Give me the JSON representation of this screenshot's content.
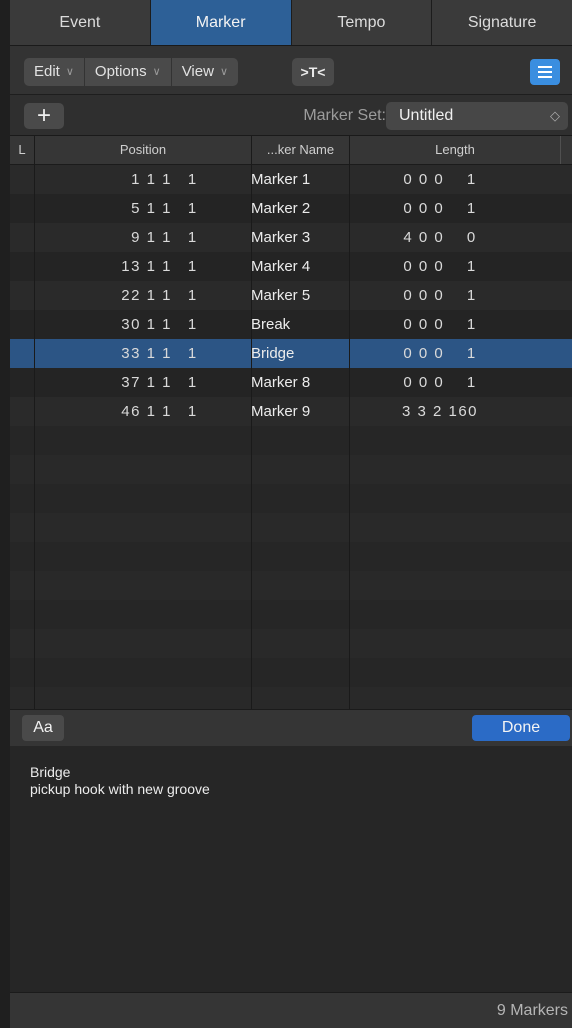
{
  "tabs": [
    "Event",
    "Marker",
    "Tempo",
    "Signature"
  ],
  "active_tab": "Marker",
  "toolbar": {
    "edit_label": "Edit",
    "options_label": "Options",
    "view_label": "View",
    "filter_glyph": ">T<",
    "chevron": "∨"
  },
  "marker_set": {
    "add_label": "+",
    "label": "Marker Set:",
    "value": "Untitled",
    "arrows": "◇"
  },
  "table": {
    "headers": {
      "l": "L",
      "position": "Position",
      "name": "...ker Name",
      "length": "Length"
    },
    "rows": [
      {
        "position": "1 1 1",
        "tick": "1",
        "name": "Marker 1",
        "length": "0 0 0    1"
      },
      {
        "position": "5 1 1",
        "tick": "1",
        "name": "Marker 2",
        "length": "0 0 0    1"
      },
      {
        "position": "9 1 1",
        "tick": "1",
        "name": "Marker 3",
        "length": "4 0 0    0"
      },
      {
        "position": "13 1 1",
        "tick": "1",
        "name": "Marker 4",
        "length": "0 0 0    1"
      },
      {
        "position": "22 1 1",
        "tick": "1",
        "name": "Marker 5",
        "length": "0 0 0    1"
      },
      {
        "position": "30 1 1",
        "tick": "1",
        "name": "Break",
        "length": "0 0 0    1"
      },
      {
        "position": "33 1 1",
        "tick": "1",
        "name": "Bridge",
        "length": "0 0 0    1"
      },
      {
        "position": "37 1 1",
        "tick": "1",
        "name": "Marker 8",
        "length": "0 0 0    1"
      },
      {
        "position": "46 1 1",
        "tick": "1",
        "name": "Marker 9",
        "length": "3 3 2 160"
      }
    ],
    "selected_index": 6
  },
  "bottom": {
    "font_label": "Aa",
    "done_label": "Done"
  },
  "note": {
    "title": "Bridge",
    "body": "pickup hook with new groove"
  },
  "status": "9 Markers",
  "colors": {
    "active_tab": "#2d6097",
    "selected_row": "#2c5585",
    "done_button": "#2b6bc6",
    "list_button": "#3a8ee0"
  }
}
